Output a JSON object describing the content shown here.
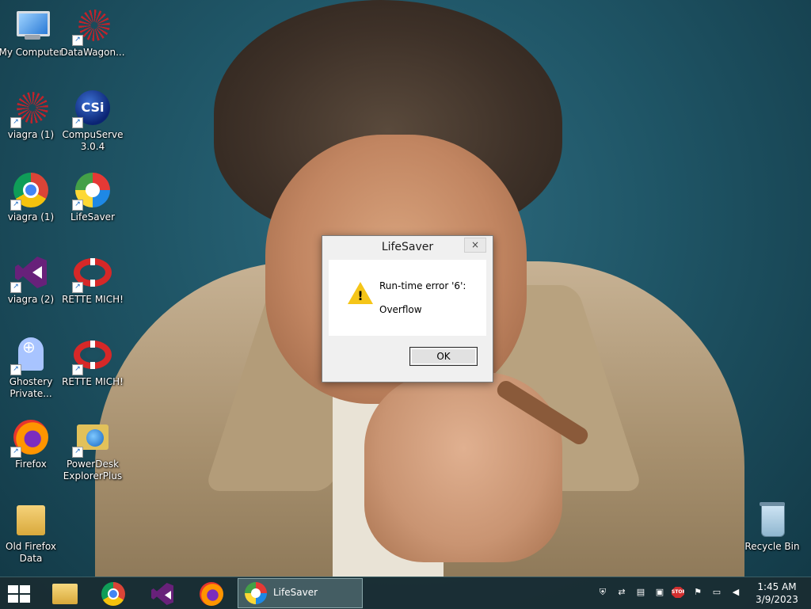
{
  "desktop": {
    "icons": [
      {
        "label": "My Computer",
        "icon": "computer-icon"
      },
      {
        "label": "DataWagon...",
        "icon": "web-icon"
      },
      {
        "label": "viagra (1)",
        "icon": "web-icon"
      },
      {
        "label": "CompuServe 3.0.4",
        "icon": "csi-icon"
      },
      {
        "label": "viagra (1)",
        "icon": "chrome-icon"
      },
      {
        "label": "LifeSaver",
        "icon": "lifesaver-icon"
      },
      {
        "label": "viagra (2)",
        "icon": "visual-studio-icon"
      },
      {
        "label": "RETTE MICH!",
        "icon": "life-ring-icon"
      },
      {
        "label": "Ghostery Private...",
        "icon": "ghostery-icon"
      },
      {
        "label": "RETTE MICH!",
        "icon": "life-ring-icon"
      },
      {
        "label": "Firefox",
        "icon": "firefox-icon"
      },
      {
        "label": "PowerDesk ExplorerPlus",
        "icon": "powerdesk-icon"
      },
      {
        "label": "Old Firefox Data",
        "icon": "folder-icon"
      },
      {
        "label": "Recycle Bin",
        "icon": "recycle-bin-icon"
      }
    ]
  },
  "dialog": {
    "title": "LifeSaver",
    "close_glyph": "×",
    "icon": "warning-icon",
    "message_line1": "Run-time error '6':",
    "message_line2": "Overflow",
    "ok_label": "OK"
  },
  "taskbar": {
    "pinned": [
      "file-explorer-icon",
      "chrome-icon",
      "visual-studio-icon",
      "firefox-icon"
    ],
    "active_window": "LifeSaver",
    "tray_icons": [
      "shield-icon",
      "network-icon",
      "device-icon",
      "clipboard-icon",
      "stop-icon",
      "flag-icon",
      "monitor-icon",
      "volume-icon"
    ],
    "stop_text": "STOP",
    "time": "1:45 AM",
    "date": "3/9/2023"
  }
}
